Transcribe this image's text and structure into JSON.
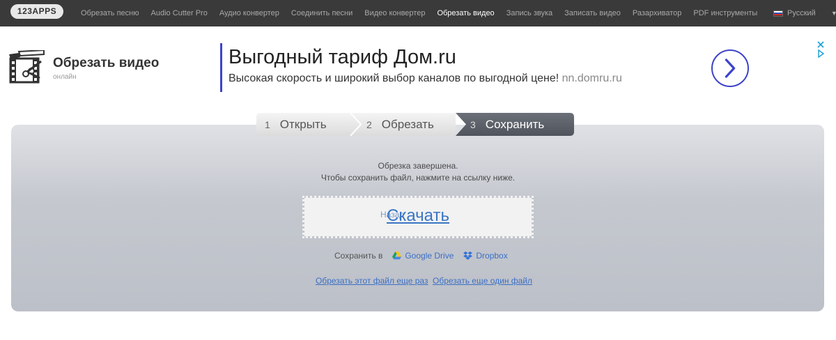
{
  "topbar": {
    "logo": "123APPS",
    "nav": [
      {
        "label": "Обрезать песню",
        "active": false
      },
      {
        "label": "Audio Cutter Pro",
        "active": false
      },
      {
        "label": "Аудио конвертер",
        "active": false
      },
      {
        "label": "Соединить песни",
        "active": false
      },
      {
        "label": "Видео конвертер",
        "active": false
      },
      {
        "label": "Обрезать видео",
        "active": true
      },
      {
        "label": "Запись звука",
        "active": false
      },
      {
        "label": "Записать видео",
        "active": false
      },
      {
        "label": "Разархиватор",
        "active": false
      },
      {
        "label": "PDF инструменты",
        "active": false
      }
    ],
    "language": "Русский"
  },
  "app": {
    "title": "Обрезать видео",
    "subtitle": "онлайн"
  },
  "ad": {
    "title": "Выгодный тариф Дом.ru",
    "text": "Высокая скорость и широкий выбор каналов по выгодной цене!",
    "domain": "nn.domru.ru",
    "accent": "#3d43c9"
  },
  "steps": [
    {
      "num": "1",
      "label": "Открыть"
    },
    {
      "num": "2",
      "label": "Обрезать"
    },
    {
      "num": "3",
      "label": "Сохранить"
    }
  ],
  "result": {
    "line1": "Обрезка завершена.",
    "line2": "Чтобы сохранить файл, нажмите на ссылку ниже.",
    "download_small": "Назад",
    "download": "Скачать",
    "save_to": "Сохранить в",
    "google_drive": "Google Drive",
    "dropbox": "Dropbox",
    "cut_again": "Обрезать этот файл еще раз",
    "cut_another": "Обрезать еще один файл"
  }
}
